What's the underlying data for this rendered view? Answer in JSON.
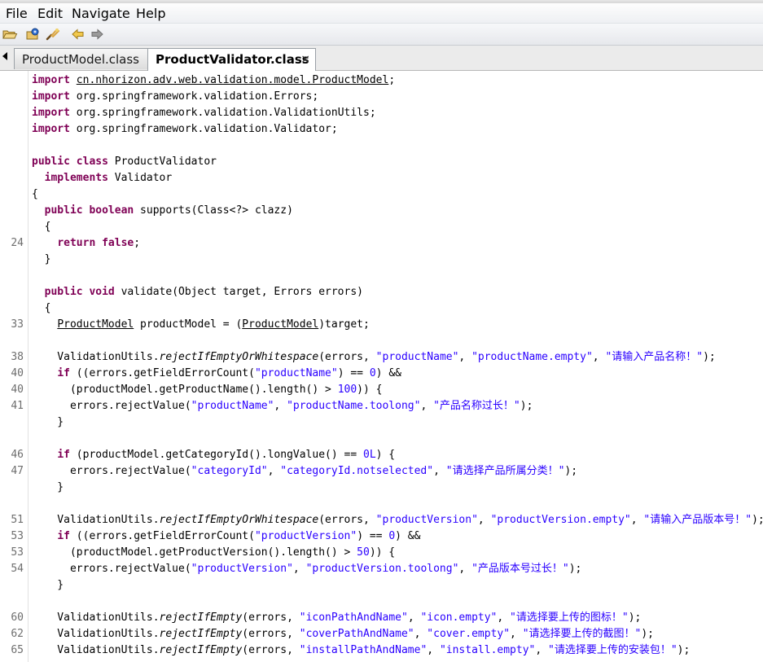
{
  "menu": [
    "File",
    "Edit",
    "Navigate",
    "Help"
  ],
  "toolbar": {
    "icons": [
      "open-folder-icon",
      "open-type-icon",
      "search-icon",
      "back-arrow-icon",
      "forward-arrow-icon"
    ]
  },
  "tabs": [
    {
      "label": "ProductModel.class",
      "active": false
    },
    {
      "label": "ProductValidator.class",
      "active": true,
      "close": "×"
    }
  ],
  "code": [
    {
      "num": "",
      "segs": [
        [
          "kw",
          "import"
        ],
        [
          "t",
          " "
        ],
        [
          "ul",
          "cn.nhorizon.adv.web.validation.model.ProductModel"
        ],
        [
          "t",
          ";"
        ]
      ]
    },
    {
      "num": "",
      "segs": [
        [
          "kw",
          "import"
        ],
        [
          "t",
          " org.springframework.validation.Errors;"
        ]
      ]
    },
    {
      "num": "",
      "segs": [
        [
          "kw",
          "import"
        ],
        [
          "t",
          " org.springframework.validation.ValidationUtils;"
        ]
      ]
    },
    {
      "num": "",
      "segs": [
        [
          "kw",
          "import"
        ],
        [
          "t",
          " org.springframework.validation.Validator;"
        ]
      ]
    },
    {
      "num": "",
      "segs": []
    },
    {
      "num": "",
      "segs": [
        [
          "kw",
          "public class"
        ],
        [
          "t",
          " ProductValidator"
        ]
      ]
    },
    {
      "num": "",
      "segs": [
        [
          "t",
          "  "
        ],
        [
          "kw",
          "implements"
        ],
        [
          "t",
          " Validator"
        ]
      ]
    },
    {
      "num": "",
      "segs": [
        [
          "t",
          "{"
        ]
      ]
    },
    {
      "num": "",
      "segs": [
        [
          "t",
          "  "
        ],
        [
          "kw",
          "public boolean"
        ],
        [
          "t",
          " supports(Class<?> clazz)"
        ]
      ]
    },
    {
      "num": "",
      "segs": [
        [
          "t",
          "  {"
        ]
      ]
    },
    {
      "num": "24",
      "segs": [
        [
          "t",
          "    "
        ],
        [
          "kw",
          "return false"
        ],
        [
          "t",
          ";"
        ]
      ]
    },
    {
      "num": "",
      "segs": [
        [
          "t",
          "  }"
        ]
      ]
    },
    {
      "num": "",
      "segs": []
    },
    {
      "num": "",
      "segs": [
        [
          "t",
          "  "
        ],
        [
          "kw",
          "public void"
        ],
        [
          "t",
          " validate(Object target, Errors errors)"
        ]
      ]
    },
    {
      "num": "",
      "segs": [
        [
          "t",
          "  {"
        ]
      ]
    },
    {
      "num": "33",
      "segs": [
        [
          "t",
          "    "
        ],
        [
          "ul",
          "ProductModel"
        ],
        [
          "t",
          " productModel = ("
        ],
        [
          "ul",
          "ProductModel"
        ],
        [
          "t",
          ")target;"
        ]
      ]
    },
    {
      "num": "",
      "segs": []
    },
    {
      "num": "38",
      "segs": [
        [
          "t",
          "    ValidationUtils."
        ],
        [
          "it",
          "rejectIfEmptyOrWhitespace"
        ],
        [
          "t",
          "(errors, "
        ],
        [
          "str",
          "\"productName\""
        ],
        [
          "t",
          ", "
        ],
        [
          "str",
          "\"productName.empty\""
        ],
        [
          "t",
          ", "
        ],
        [
          "str",
          "\"请输入产品名称！\""
        ],
        [
          "t",
          ");"
        ]
      ]
    },
    {
      "num": "40",
      "segs": [
        [
          "t",
          "    "
        ],
        [
          "kw",
          "if"
        ],
        [
          "t",
          " ((errors.getFieldErrorCount("
        ],
        [
          "str",
          "\"productName\""
        ],
        [
          "t",
          ") == "
        ],
        [
          "str",
          "0"
        ],
        [
          "t",
          ") &&"
        ]
      ]
    },
    {
      "num": "40",
      "segs": [
        [
          "t",
          "      (productModel.getProductName().length() > "
        ],
        [
          "str",
          "100"
        ],
        [
          "t",
          ")) {"
        ]
      ]
    },
    {
      "num": "41",
      "segs": [
        [
          "t",
          "      errors.rejectValue("
        ],
        [
          "str",
          "\"productName\""
        ],
        [
          "t",
          ", "
        ],
        [
          "str",
          "\"productName.toolong\""
        ],
        [
          "t",
          ", "
        ],
        [
          "str",
          "\"产品名称过长！\""
        ],
        [
          "t",
          ");"
        ]
      ]
    },
    {
      "num": "",
      "segs": [
        [
          "t",
          "    }"
        ]
      ]
    },
    {
      "num": "",
      "segs": []
    },
    {
      "num": "46",
      "segs": [
        [
          "t",
          "    "
        ],
        [
          "kw",
          "if"
        ],
        [
          "t",
          " (productModel.getCategoryId().longValue() == "
        ],
        [
          "str",
          "0L"
        ],
        [
          "t",
          ") {"
        ]
      ]
    },
    {
      "num": "47",
      "segs": [
        [
          "t",
          "      errors.rejectValue("
        ],
        [
          "str",
          "\"categoryId\""
        ],
        [
          "t",
          ", "
        ],
        [
          "str",
          "\"categoryId.notselected\""
        ],
        [
          "t",
          ", "
        ],
        [
          "str",
          "\"请选择产品所属分类！\""
        ],
        [
          "t",
          ");"
        ]
      ]
    },
    {
      "num": "",
      "segs": [
        [
          "t",
          "    }"
        ]
      ]
    },
    {
      "num": "",
      "segs": []
    },
    {
      "num": "51",
      "segs": [
        [
          "t",
          "    ValidationUtils."
        ],
        [
          "it",
          "rejectIfEmptyOrWhitespace"
        ],
        [
          "t",
          "(errors, "
        ],
        [
          "str",
          "\"productVersion\""
        ],
        [
          "t",
          ", "
        ],
        [
          "str",
          "\"productVersion.empty\""
        ],
        [
          "t",
          ", "
        ],
        [
          "str",
          "\"请输入产品版本号！\""
        ],
        [
          "t",
          ");"
        ]
      ]
    },
    {
      "num": "53",
      "segs": [
        [
          "t",
          "    "
        ],
        [
          "kw",
          "if"
        ],
        [
          "t",
          " ((errors.getFieldErrorCount("
        ],
        [
          "str",
          "\"productVersion\""
        ],
        [
          "t",
          ") == "
        ],
        [
          "str",
          "0"
        ],
        [
          "t",
          ") &&"
        ]
      ]
    },
    {
      "num": "53",
      "segs": [
        [
          "t",
          "      (productModel.getProductVersion().length() > "
        ],
        [
          "str",
          "50"
        ],
        [
          "t",
          ")) {"
        ]
      ]
    },
    {
      "num": "54",
      "segs": [
        [
          "t",
          "      errors.rejectValue("
        ],
        [
          "str",
          "\"productVersion\""
        ],
        [
          "t",
          ", "
        ],
        [
          "str",
          "\"productVersion.toolong\""
        ],
        [
          "t",
          ", "
        ],
        [
          "str",
          "\"产品版本号过长！\""
        ],
        [
          "t",
          ");"
        ]
      ]
    },
    {
      "num": "",
      "segs": [
        [
          "t",
          "    }"
        ]
      ]
    },
    {
      "num": "",
      "segs": []
    },
    {
      "num": "60",
      "segs": [
        [
          "t",
          "    ValidationUtils."
        ],
        [
          "it",
          "rejectIfEmpty"
        ],
        [
          "t",
          "(errors, "
        ],
        [
          "str",
          "\"iconPathAndName\""
        ],
        [
          "t",
          ", "
        ],
        [
          "str",
          "\"icon.empty\""
        ],
        [
          "t",
          ", "
        ],
        [
          "str",
          "\"请选择要上传的图标！\""
        ],
        [
          "t",
          ");"
        ]
      ]
    },
    {
      "num": "62",
      "segs": [
        [
          "t",
          "    ValidationUtils."
        ],
        [
          "it",
          "rejectIfEmpty"
        ],
        [
          "t",
          "(errors, "
        ],
        [
          "str",
          "\"coverPathAndName\""
        ],
        [
          "t",
          ", "
        ],
        [
          "str",
          "\"cover.empty\""
        ],
        [
          "t",
          ", "
        ],
        [
          "str",
          "\"请选择要上传的截图！\""
        ],
        [
          "t",
          ");"
        ]
      ]
    },
    {
      "num": "65",
      "segs": [
        [
          "t",
          "    ValidationUtils."
        ],
        [
          "it",
          "rejectIfEmpty"
        ],
        [
          "t",
          "(errors, "
        ],
        [
          "str",
          "\"installPathAndName\""
        ],
        [
          "t",
          ", "
        ],
        [
          "str",
          "\"install.empty\""
        ],
        [
          "t",
          ", "
        ],
        [
          "str",
          "\"请选择要上传的安装包！\""
        ],
        [
          "t",
          ");"
        ]
      ]
    }
  ]
}
